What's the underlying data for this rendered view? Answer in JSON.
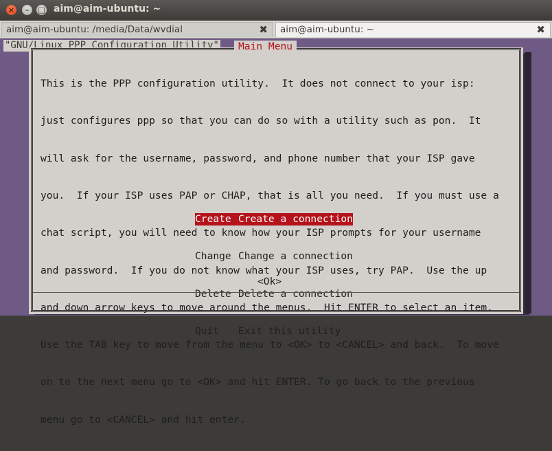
{
  "window": {
    "title": "aim@aim-ubuntu: ~"
  },
  "tabs": [
    {
      "label": "aim@aim-ubuntu: /media/Data/wvdial"
    },
    {
      "label": "aim@aim-ubuntu: ~"
    }
  ],
  "terminal": {
    "backtitle": "\"GNU/Linux PPP Configuration Utility\"",
    "dialog_title": "Main Menu",
    "description": [
      "This is the PPP configuration utility.  It does not connect to your isp:",
      "just configures ppp so that you can do so with a utility such as pon.  It",
      "will ask for the username, password, and phone number that your ISP gave",
      "you.  If your ISP uses PAP or CHAP, that is all you need.  If you must use a",
      "chat script, you will need to know how your ISP prompts for your username",
      "and password.  If you do not know what your ISP uses, try PAP.  Use the up",
      "and down arrow keys to move around the menus.  Hit ENTER to select an item.",
      "Use the TAB key to move from the menu to <OK> to <CANCEL> and back.  To move",
      "on to the next menu go to <OK> and hit ENTER. To go back to the previous",
      "menu go to <CANCEL> and hit enter."
    ],
    "menu": [
      {
        "tag": "Create",
        "desc": "Create a connection",
        "selected": true
      },
      {
        "tag": "Change",
        "desc": "Change a connection",
        "selected": false
      },
      {
        "tag": "Delete",
        "desc": "Delete a connection",
        "selected": false
      },
      {
        "tag": "Quit",
        "desc": "Exit this utility",
        "selected": false
      }
    ],
    "ok_label": "<Ok>"
  }
}
